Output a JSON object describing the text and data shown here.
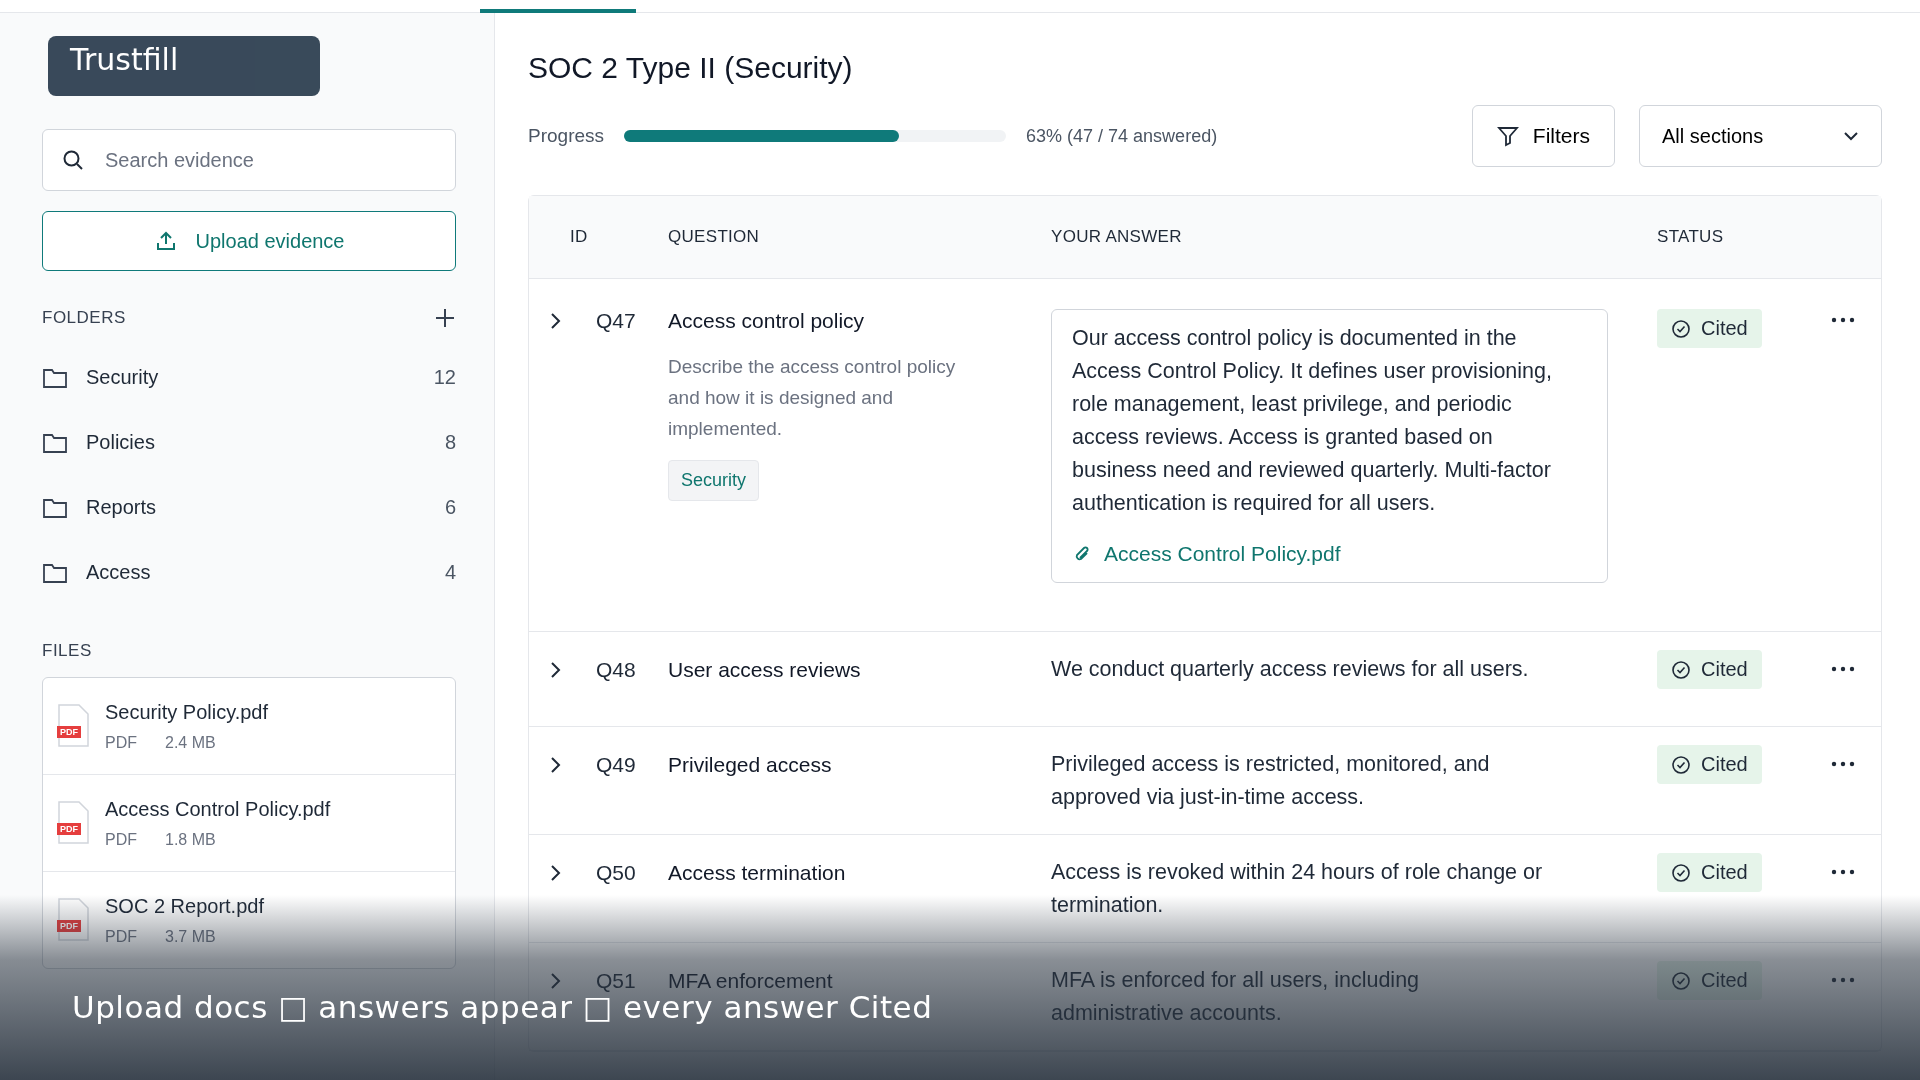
{
  "overlay": {
    "badge": "Trustfill",
    "caption": "Upload docs □ answers appear □ every answer Cited"
  },
  "sidebar": {
    "search": {
      "placeholder": "Search evidence"
    },
    "upload_button": "Upload evidence",
    "folders_heading": "FOLDERS",
    "folders": [
      {
        "name": "Security",
        "count": "12"
      },
      {
        "name": "Policies",
        "count": "8"
      },
      {
        "name": "Reports",
        "count": "6"
      },
      {
        "name": "Access",
        "count": "4"
      }
    ],
    "files_heading": "FILES",
    "files": [
      {
        "name": "Security Policy.pdf",
        "type": "PDF",
        "size": "2.4 MB",
        "badge": "PDF"
      },
      {
        "name": "Access Control Policy.pdf",
        "type": "PDF",
        "size": "1.8 MB",
        "badge": "PDF"
      },
      {
        "name": "SOC 2 Report.pdf",
        "type": "PDF",
        "size": "3.7 MB",
        "badge": "PDF"
      }
    ]
  },
  "main": {
    "title": "SOC 2 Type II (Security)",
    "progress": {
      "label": "Progress",
      "level": 0.72,
      "reading": "63% (47 / 74 answered)"
    },
    "filters_button": "Filters",
    "section_select": "All sections",
    "table": {
      "columns": [
        "ID",
        "QUESTION",
        "YOUR ANSWER",
        "STATUS"
      ],
      "rows": [
        {
          "id": "Q47",
          "question": "Access control policy",
          "description": "Describe the access control policy and how it is designed and implemented.",
          "tag": "Security",
          "answer": "Our access control policy is documented in the Access Control Policy. It defines user provisioning, role management, least privilege, and periodic access reviews. Access is granted based on business need and reviewed quarterly. Multi-factor authentication is required for all users.",
          "attachment": "Access Control Policy.pdf",
          "status": "Cited"
        },
        {
          "id": "Q48",
          "question": "User access reviews",
          "answer": "We conduct quarterly access reviews for all users.",
          "status": "Cited"
        },
        {
          "id": "Q49",
          "question": "Privileged access",
          "answer": "Privileged access is restricted, monitored, and approved via just-in-time access.",
          "status": "Cited"
        },
        {
          "id": "Q50",
          "question": "Access termination",
          "answer": "Access is revoked within 24 hours of role change or termination.",
          "status": "Cited"
        },
        {
          "id": "Q51",
          "question": "MFA enforcement",
          "answer": "MFA is enforced for all users, including administrative accounts.",
          "status": "Cited"
        }
      ]
    }
  }
}
